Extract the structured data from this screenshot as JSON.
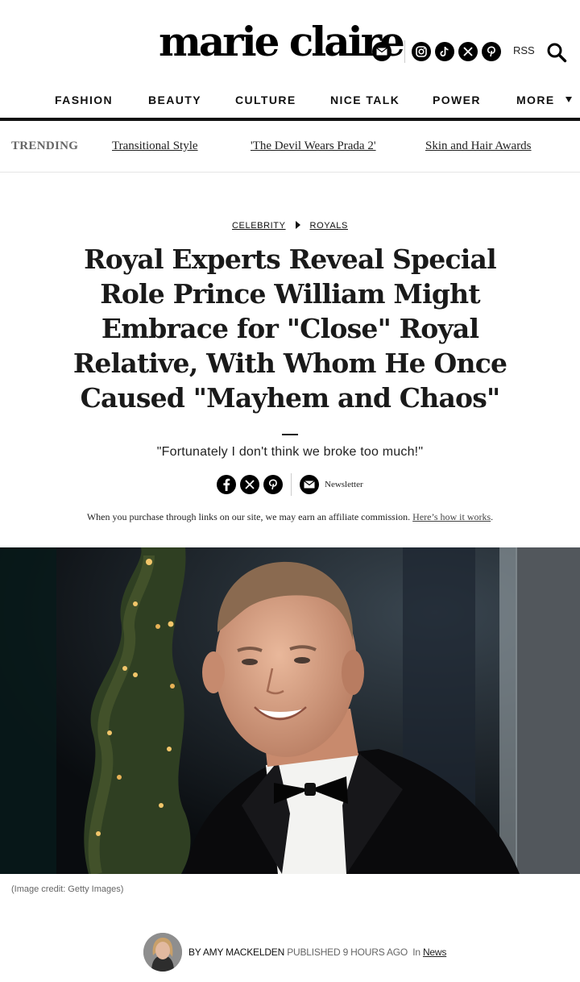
{
  "header": {
    "logo_text": "marie claire",
    "social": [
      "instagram-icon",
      "tiktok-icon",
      "x-icon",
      "pinterest-icon"
    ],
    "rss_label": "RSS"
  },
  "nav": {
    "items": [
      "FASHION",
      "BEAUTY",
      "CULTURE",
      "NICE TALK",
      "POWER",
      "MORE"
    ]
  },
  "trending": {
    "label": "TRENDING",
    "links": [
      "Transitional Style",
      "'The Devil Wears Prada 2'",
      "Skin and Hair Awards"
    ]
  },
  "article": {
    "breadcrumbs": [
      "CELEBRITY",
      "ROYALS"
    ],
    "title": "Royal Experts Reveal Special Role Prince William Might Embrace for \"Close\" Royal Relative, With Whom He Once Caused \"Mayhem and Chaos\"",
    "strapline": "\"Fortunately I don't think we broke too much!\"",
    "newsletter_label": "Newsletter",
    "affiliate_text": "When you purchase through links on our site, we may earn an affiliate commission.",
    "affiliate_link": "Here’s how it works",
    "affiliate_end": ".",
    "image_credit": "(Image credit: Getty Images)",
    "byline": {
      "by": "BY AMY MACKELDEN",
      "published": "PUBLISHED 9 HOURS AGO",
      "in_label": "In",
      "category": "News"
    }
  },
  "colors": {
    "text": "#111111",
    "muted": "#666666",
    "icon_bg": "#000000",
    "background": "#ffffff"
  }
}
